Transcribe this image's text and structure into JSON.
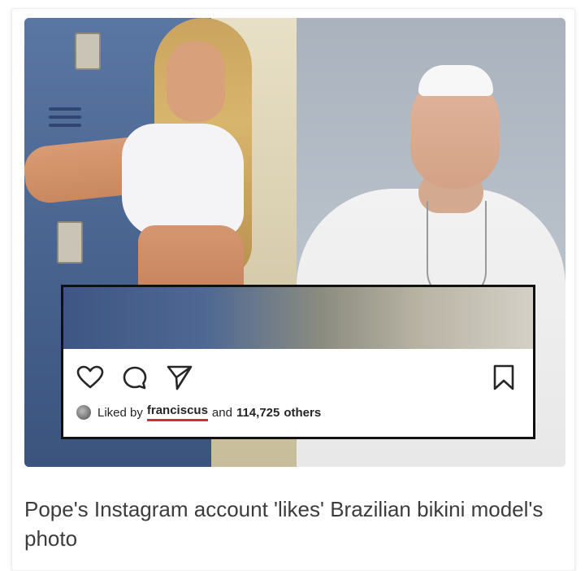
{
  "instagram": {
    "liked_by_prefix": "Liked by",
    "liked_by_user": "franciscus",
    "liked_by_middle": "and",
    "like_count": "114,725",
    "liked_by_suffix": "others",
    "underline_color": "#d32f2f"
  },
  "icons": {
    "like": "heart-icon",
    "comment": "comment-bubble-icon",
    "share": "paper-plane-icon",
    "save": "bookmark-icon",
    "avatar": "avatar"
  },
  "article": {
    "caption": "Pope's Instagram account 'likes' Brazilian bikini model's photo"
  }
}
